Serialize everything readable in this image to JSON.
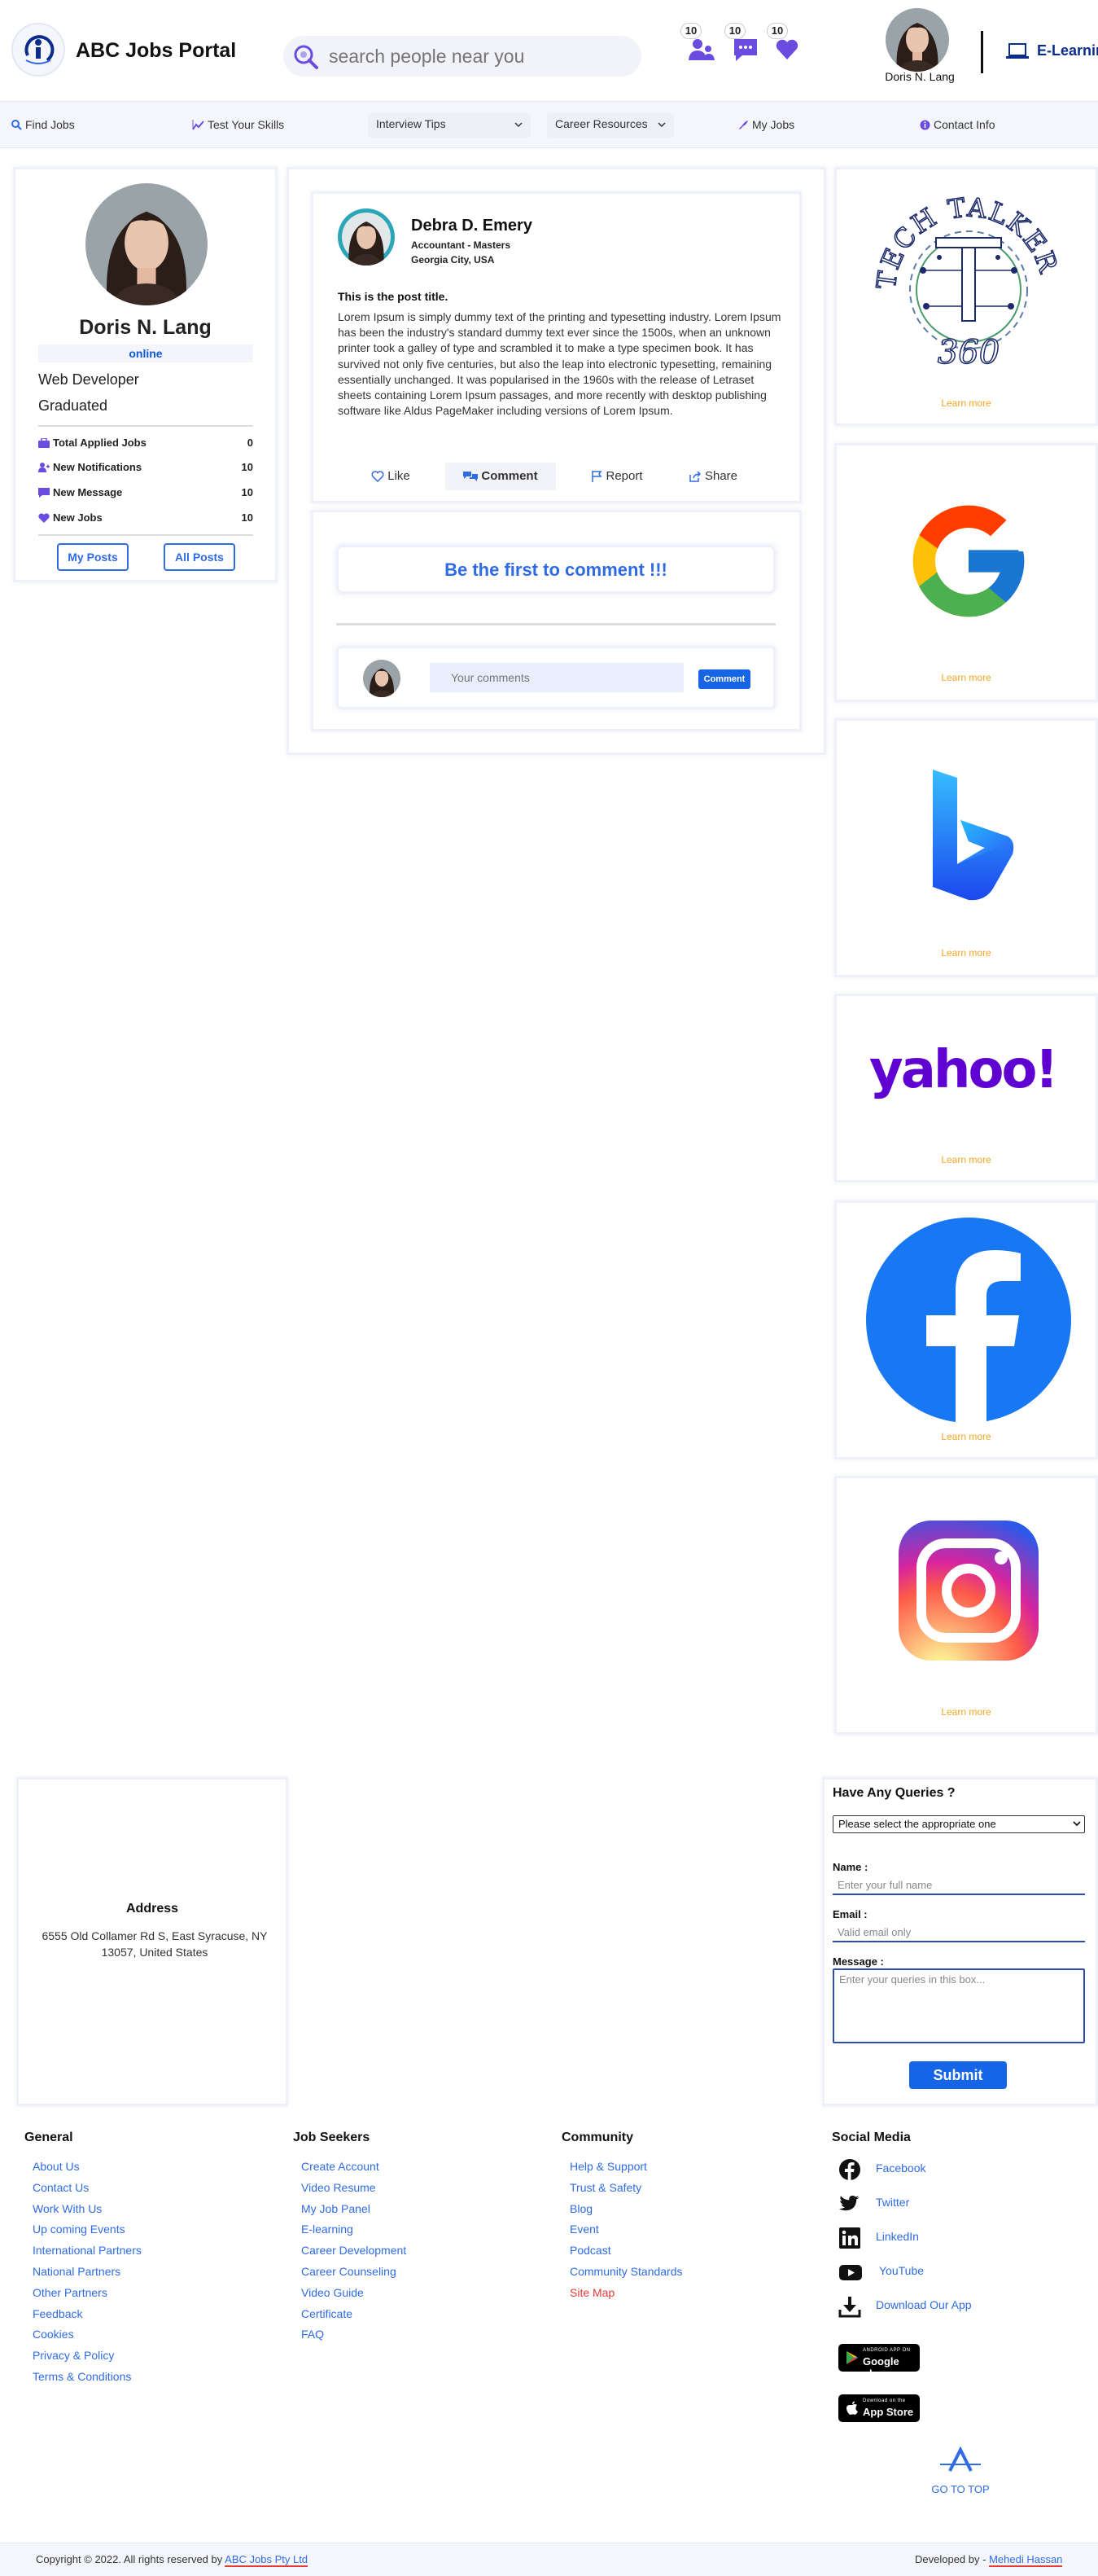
{
  "header": {
    "brand": "ABC Jobs Portal",
    "search_placeholder": "search people near you",
    "badges": {
      "requests": "10",
      "messages": "10",
      "favorites": "10"
    },
    "user_name": "Doris N. Lang",
    "elearning": "E-Learning"
  },
  "nav": {
    "find_jobs": "Find Jobs",
    "test_skills": "Test Your Skills",
    "interview_tips": "Interview Tips",
    "career_resources": "Career Resources",
    "my_jobs": "My Jobs",
    "contact_info": "Contact Info"
  },
  "profile": {
    "name": "Doris N. Lang",
    "status": "online",
    "role": "Web Developer",
    "education": "Graduated",
    "stats": [
      {
        "label": "Total Applied Jobs",
        "value": "0"
      },
      {
        "label": "New Notifications",
        "value": "10"
      },
      {
        "label": "New Message",
        "value": "10"
      },
      {
        "label": "New Jobs",
        "value": "10"
      }
    ],
    "my_posts": "My Posts",
    "all_posts": "All Posts"
  },
  "post": {
    "author": "Debra D. Emery",
    "author_role": "Accountant - Masters",
    "author_location": "Georgia City, USA",
    "title": "This is the post title.",
    "body": "Lorem Ipsum is simply dummy text of the printing and typesetting industry. Lorem Ipsum has been the industry's standard dummy text ever since the 1500s, when an unknown printer took a galley of type and scrambled it to make a type specimen book. It has survived not only five centuries, but also the leap into electronic typesetting, remaining essentially unchanged. It was popularised in the 1960s with the release of Letraset sheets containing Lorem Ipsum passages, and more recently with desktop publishing software like Aldus PageMaker including versions of Lorem Ipsum.",
    "actions": {
      "like": "Like",
      "comment": "Comment",
      "report": "Report",
      "share": "Share"
    }
  },
  "comments": {
    "empty_message": "Be the first to comment !!!",
    "input_placeholder": "Your comments",
    "submit": "Comment"
  },
  "ads": {
    "learn_more": "Learn more",
    "techtalker_top": "TECH TALKER",
    "techtalker_num": "360",
    "yahoo": "yahoo!"
  },
  "contact": {
    "address_title": "Address",
    "address": "6555 Old Collamer Rd S, East Syracuse, NY 13057, United States",
    "queries_title": "Have Any Queries ?",
    "select_value": "Please select the appropriate one",
    "name_label": "Name :",
    "name_placeholder": "Enter your full name",
    "email_label": "Email :",
    "email_placeholder": "Valid email only",
    "message_label": "Message :",
    "message_placeholder": "Enter your queries in this box...",
    "submit": "Submit"
  },
  "footer": {
    "general": {
      "title": "General",
      "links": [
        "About Us",
        "Contact Us",
        "Work With Us",
        "Up coming Events",
        "International Partners",
        "National Partners",
        "Other Partners",
        "Feedback",
        "Cookies",
        "Privacy & Policy",
        "Terms & Conditions"
      ]
    },
    "job_seekers": {
      "title": "Job Seekers",
      "links": [
        "Create Account",
        "Video Resume",
        "My Job Panel",
        "E-learning",
        "Career Development",
        "Career Counseling",
        "Video Guide",
        "Certificate",
        "FAQ"
      ]
    },
    "community": {
      "title": "Community",
      "links": [
        "Help & Support",
        "Trust & Safety",
        "Blog",
        "Event",
        "Podcast",
        "Community Standards",
        "Site Map"
      ]
    },
    "social": {
      "title": "Social Media",
      "links": [
        "Facebook",
        "Twitter",
        "LinkedIn",
        "YouTube",
        "Download Our App"
      ]
    },
    "google_play_small": "ANDROID APP ON",
    "google_play": "Google play",
    "app_store_small": "Download on the",
    "app_store": "App Store",
    "go_to_top": "GO TO TOP",
    "copyright": "Copyright © 2022. All rights reserved by",
    "copyright_owner": "ABC Jobs Pty Ltd",
    "developed_by": "Developed by -",
    "developer": "Mehedi Hassan"
  },
  "colors": {
    "accent": "#2e6be4",
    "brand_dark": "#0a2c8a",
    "icon_purple": "#6a4de0",
    "learn_more": "#f5a623",
    "site_map": "#e53935"
  }
}
